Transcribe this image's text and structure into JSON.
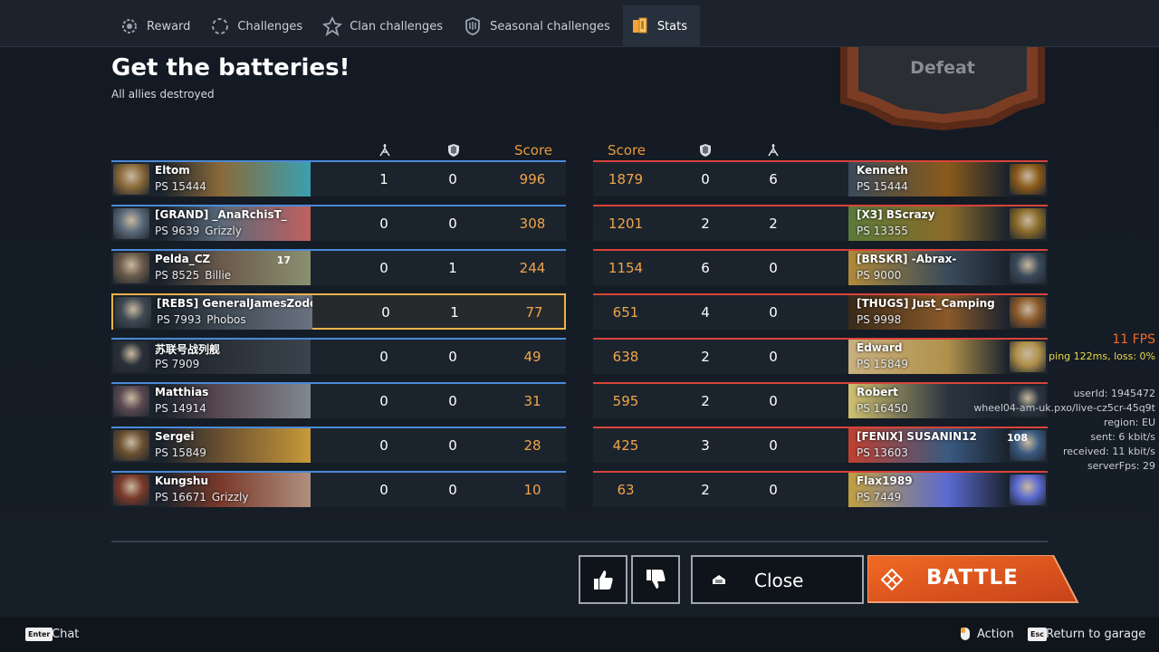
{
  "tabs": [
    {
      "label": "Reward",
      "icon": "reward-gear-icon",
      "active": false
    },
    {
      "label": "Challenges",
      "icon": "challenges-icon",
      "active": false
    },
    {
      "label": "Clan challenges",
      "icon": "clan-challenges-icon",
      "active": false
    },
    {
      "label": "Seasonal challenges",
      "icon": "seasonal-challenges-icon",
      "active": false
    },
    {
      "label": "Stats",
      "icon": "stats-cards-icon",
      "active": true
    }
  ],
  "mission": {
    "title": "Get the batteries!",
    "subtitle": "All allies destroyed",
    "result": "Defeat"
  },
  "columns": {
    "score": "Score"
  },
  "allies": [
    {
      "name": "Eltom",
      "ps": "PS 15444",
      "clan": "",
      "kills": "1",
      "assists": "0",
      "score": "996"
    },
    {
      "name": "[GRAND] _AnaRchisT_",
      "ps": "PS 9639",
      "clan": "Grizzly",
      "kills": "0",
      "assists": "0",
      "score": "308"
    },
    {
      "name": "Pelda_CZ",
      "ps": "PS 8525",
      "clan": "Billie",
      "level": "17",
      "kills": "0",
      "assists": "1",
      "score": "244"
    },
    {
      "name": "[REBS] GeneralJamesZodd",
      "ps": "PS 7993",
      "clan": "Phobos",
      "kills": "0",
      "assists": "1",
      "score": "77",
      "self": true
    },
    {
      "name": "苏联号战列舰",
      "ps": "PS 7909",
      "clan": "",
      "kills": "0",
      "assists": "0",
      "score": "49"
    },
    {
      "name": "Matthias",
      "ps": "PS 14914",
      "clan": "",
      "kills": "0",
      "assists": "0",
      "score": "31"
    },
    {
      "name": "Sergei",
      "ps": "PS 15849",
      "clan": "",
      "kills": "0",
      "assists": "0",
      "score": "28"
    },
    {
      "name": "Kungshu",
      "ps": "PS 16671",
      "clan": "Grizzly",
      "kills": "0",
      "assists": "0",
      "score": "10"
    }
  ],
  "enemies": [
    {
      "name": "Kenneth",
      "ps": "PS 15444",
      "score": "1879",
      "assists": "0",
      "kills": "6"
    },
    {
      "name": "[X3] BScrazy",
      "ps": "PS 13355",
      "score": "1201",
      "assists": "2",
      "kills": "2"
    },
    {
      "name": "[BRSKR] -Abrax-",
      "ps": "PS 9000",
      "score": "1154",
      "assists": "6",
      "kills": "0"
    },
    {
      "name": "[THUGS] Just_Camping",
      "ps": "PS 9998",
      "score": "651",
      "assists": "4",
      "kills": "0"
    },
    {
      "name": "Edward",
      "ps": "PS 15849",
      "score": "638",
      "assists": "2",
      "kills": "0"
    },
    {
      "name": "Robert",
      "ps": "PS 16450",
      "score": "595",
      "assists": "2",
      "kills": "0"
    },
    {
      "name": "[FENIX] SUSANIN12",
      "ps": "PS 13603",
      "level": "108",
      "score": "425",
      "assists": "3",
      "kills": "0"
    },
    {
      "name": "Flax1989",
      "ps": "PS 7449",
      "score": "63",
      "assists": "2",
      "kills": "0"
    }
  ],
  "buttons": {
    "close": "Close",
    "battle": "BATTLE"
  },
  "bottom": {
    "chat_key": "Enter",
    "chat": "Chat",
    "action": "Action",
    "return_key": "Esc",
    "return": "Return to garage"
  },
  "debug": {
    "fps": "11 FPS",
    "ping": "ping 122ms, loss:  0%",
    "user_id": "userId: 1945472",
    "server": "wheel04-am-uk.pxo/live-cz5cr-45q9t",
    "region": "region: EU",
    "sent": "sent: 6 kbit/s",
    "received": "received: 11 kbit/s",
    "server_fps": "serverFps: 29"
  },
  "colors": {
    "ally": "#4a8ad8",
    "enemy": "#d8433a",
    "score": "#f0a54a",
    "highlight": "#f0b24a",
    "battle": "#e0541e"
  }
}
